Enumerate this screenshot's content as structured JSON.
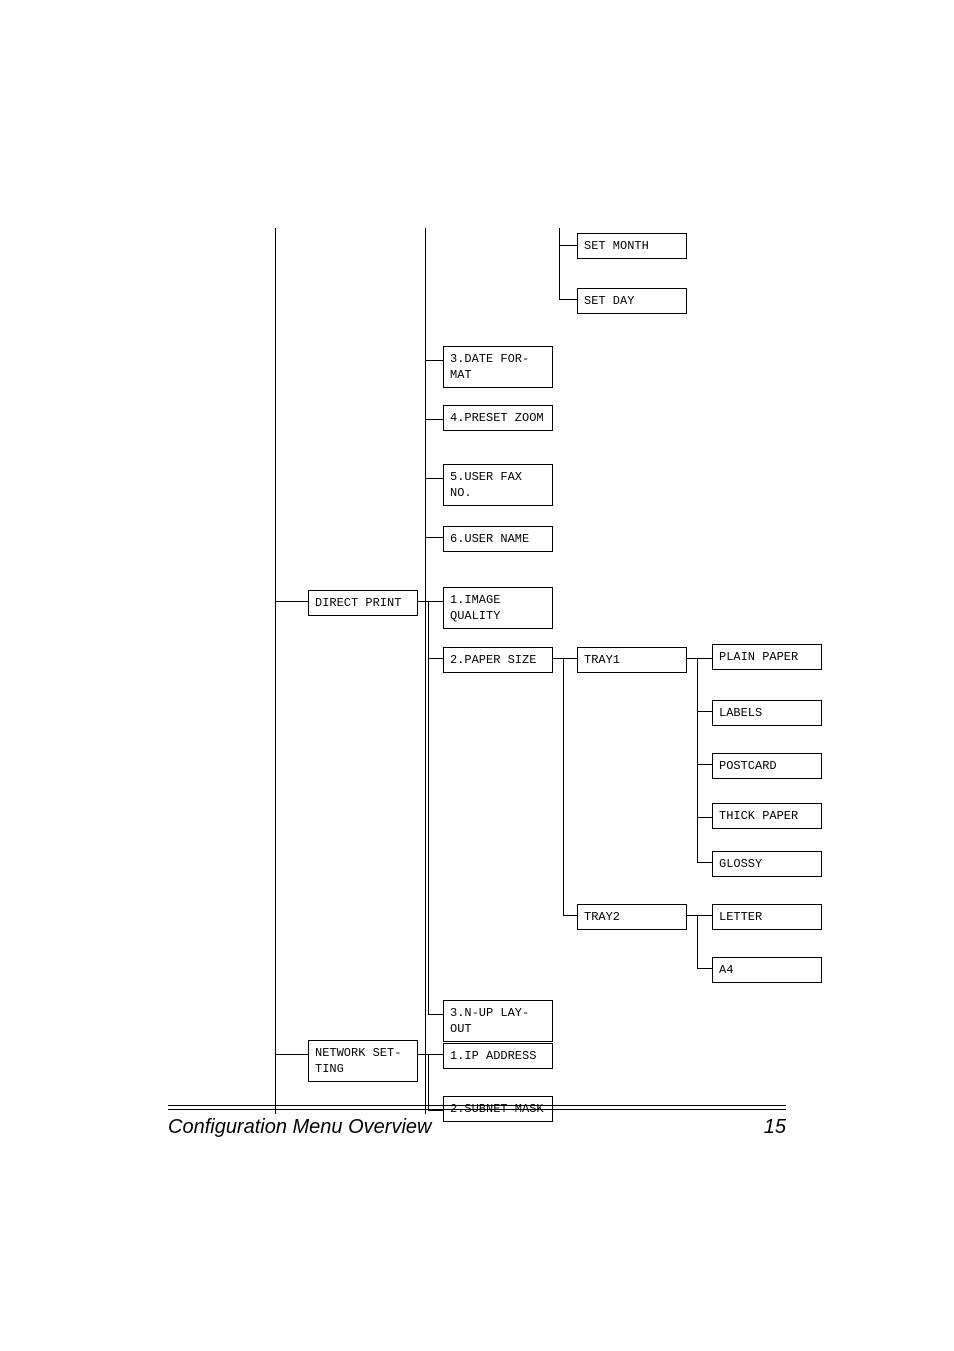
{
  "footer": {
    "title": "Configuration Menu Overview",
    "page": "15"
  },
  "nodes": {
    "set_month": "SET MONTH",
    "set_day": "SET DAY",
    "date_format": "3.DATE FOR-MAT",
    "preset_zoom": "4.PRESET ZOOM",
    "user_fax": "5.USER FAX NO.",
    "user_name": "6.USER NAME",
    "direct_print": "DIRECT PRINT",
    "image_quality": "1.IMAGE QUALITY",
    "paper_size": "2.PAPER SIZE",
    "tray1": "TRAY1",
    "plain_paper": "PLAIN PAPER",
    "labels": "LABELS",
    "postcard": "POSTCARD",
    "thick_paper": "THICK PAPER",
    "glossy": "GLOSSY",
    "tray2": "TRAY2",
    "letter": "LETTER",
    "a4": "A4",
    "nup_layout": "3.N-UP LAY-OUT",
    "network_setting": "NETWORK SET-TING",
    "ip_address": "1.IP ADDRESS",
    "subnet_mask": "2.SUBNET MASK"
  }
}
